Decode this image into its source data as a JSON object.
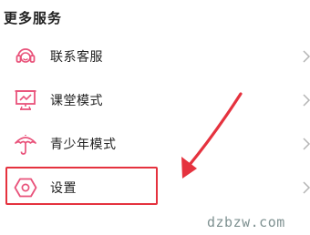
{
  "section": {
    "title": "更多服务"
  },
  "items": [
    {
      "icon": "headset-icon",
      "label": "联系客服"
    },
    {
      "icon": "classroom-icon",
      "label": "课堂模式"
    },
    {
      "icon": "umbrella-icon",
      "label": "青少年模式"
    },
    {
      "icon": "hexagon-settings-icon",
      "label": "设置"
    }
  ],
  "colors": {
    "icon_accent": "#e9537b",
    "annotation_red": "#e5323e",
    "chevron": "#b5b5b5",
    "watermark": "#7f9191"
  },
  "watermark": {
    "text": "dzbzw.com"
  }
}
